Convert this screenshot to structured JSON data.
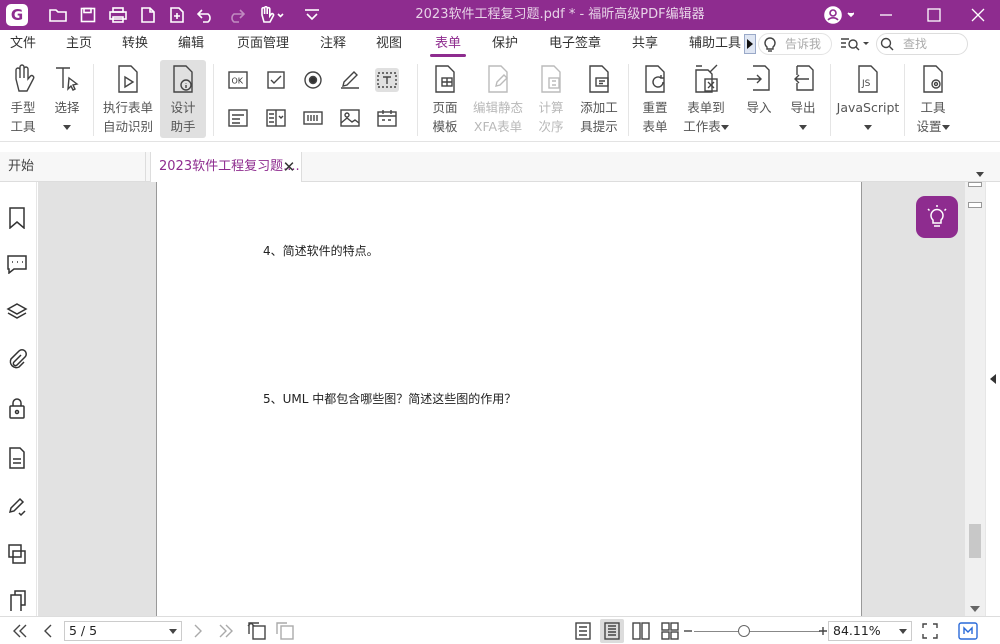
{
  "window": {
    "title": "2023软件工程复习题.pdf * - 福昕高级PDF编辑器"
  },
  "app": {
    "logo_letter": "G"
  },
  "menu": {
    "items": [
      "文件",
      "主页",
      "转换",
      "编辑",
      "页面管理",
      "注释",
      "视图",
      "表单",
      "保护",
      "电子签章",
      "共享",
      "辅助工具"
    ],
    "active": "表单",
    "tellme_placeholder": "告诉我",
    "search_placeholder": "查找"
  },
  "ribbon": {
    "hand_tool": "手型\n工具",
    "select": "选择",
    "run_form_recognition": "执行表单\n自动识别",
    "design_assistant": "设计\n助手",
    "ok_field": "OK",
    "page_template": "页面\n模板",
    "edit_static_xfa": "编辑静态\nXFA表单",
    "calc_order": "计算\n次序",
    "add_tooltip": "添加工\n具提示",
    "reset_form": "重置\n表单",
    "form_to_sheet": "表单到\n工作表",
    "import": "导入",
    "export": "导出",
    "javascript": "JavaScript",
    "tool_settings": "工具\n设置"
  },
  "tabs": {
    "start": "开始",
    "document": "2023软件工程复习题...."
  },
  "document": {
    "q4": "4、简述软件的特点。",
    "q5": "5、UML 中都包含哪些图？简述这些图的作用？"
  },
  "status": {
    "page": "5 / 5",
    "zoom": "84.11%",
    "zoom_progress": 0.4
  },
  "colors": {
    "accent": "#8e2c8f"
  }
}
